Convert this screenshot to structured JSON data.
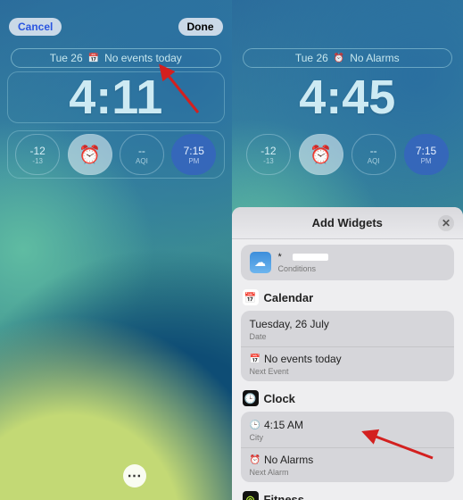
{
  "left": {
    "cancel": "Cancel",
    "done": "Done",
    "statusDate": "Tue 26",
    "statusText": "No events today",
    "time": "4:11",
    "widgets": {
      "weather_hi": "-12",
      "weather_lo": "-13",
      "aqi_value": "--",
      "aqi_label": "AQI",
      "world_time": "7:15",
      "world_ampm": "PM"
    },
    "moreGlyph": "⋯"
  },
  "right": {
    "statusDate": "Tue 26",
    "statusText": "No Alarms",
    "time": "4:45",
    "widgets": {
      "weather_hi": "-12",
      "weather_lo": "-13",
      "aqi_value": "--",
      "aqi_label": "AQI",
      "world_time": "7:15",
      "world_ampm": "PM"
    },
    "sheet": {
      "title": "Add Widgets",
      "weather": {
        "label": "Conditions",
        "temp": "*"
      },
      "sections": [
        {
          "icon": "📅",
          "iconBg": "#ffffff",
          "iconFg": "#e03b3b",
          "name": "Calendar",
          "rows": [
            {
              "icon": "",
              "main": "Tuesday, 26 July",
              "sub": "Date"
            },
            {
              "icon": "📅",
              "main": "No events today",
              "sub": "Next Event"
            }
          ]
        },
        {
          "icon": "🕒",
          "iconBg": "#111111",
          "iconFg": "#ffffff",
          "name": "Clock",
          "rows": [
            {
              "icon": "🕒",
              "main": "4:15 AM",
              "sub": "City"
            },
            {
              "icon": "⏰",
              "main": "No Alarms",
              "sub": "Next Alarm"
            }
          ]
        },
        {
          "icon": "◎",
          "iconBg": "#111111",
          "iconFg": "#c7ff3d",
          "name": "Fitness",
          "rows": []
        }
      ]
    }
  }
}
